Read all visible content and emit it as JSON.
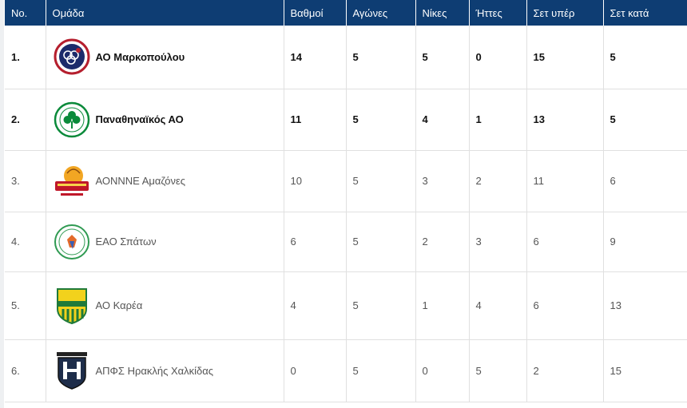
{
  "colors": {
    "header_bg": "#0e3d73",
    "header_text": "#ffffff",
    "row_border": "#e0e0e0",
    "text": "#555555"
  },
  "table": {
    "headers": [
      "No.",
      "Ομάδα",
      "Βαθμοί",
      "Αγώνες",
      "Νίκες",
      "Ήττες",
      "Σετ υπέρ",
      "Σετ κατά"
    ],
    "rows": [
      {
        "rank": "1.",
        "team": "ΑΟ Μαρκοπούλου",
        "logo_icon": "markopoulo-club-logo-icon",
        "points": "14",
        "games": "5",
        "wins": "5",
        "losses": "0",
        "sets_for": "15",
        "sets_against": "5",
        "bold": true
      },
      {
        "rank": "2.",
        "team": "Παναθηναϊκός ΑΟ",
        "logo_icon": "panathinaikos-shamrock-logo-icon",
        "points": "11",
        "games": "5",
        "wins": "4",
        "losses": "1",
        "sets_for": "13",
        "sets_against": "5",
        "bold": true
      },
      {
        "rank": "3.",
        "team": "ΑΟΝΝΝΕ Αμαζόνες",
        "logo_icon": "amazones-volleyball-logo-icon",
        "points": "10",
        "games": "5",
        "wins": "3",
        "losses": "2",
        "sets_for": "11",
        "sets_against": "6",
        "bold": false
      },
      {
        "rank": "4.",
        "team": "ΕΑΟ Σπάτων",
        "logo_icon": "spata-1991-logo-icon",
        "points": "6",
        "games": "5",
        "wins": "2",
        "losses": "3",
        "sets_for": "6",
        "sets_against": "9",
        "bold": false
      },
      {
        "rank": "5.",
        "team": "ΑΟ Καρέα",
        "logo_icon": "karea-shield-logo-icon",
        "points": "4",
        "games": "5",
        "wins": "1",
        "losses": "4",
        "sets_for": "6",
        "sets_against": "13",
        "bold": false
      },
      {
        "rank": "6.",
        "team": "ΑΠΦΣ Ηρακλής Χαλκίδας",
        "logo_icon": "iraklis-chalkida-logo-icon",
        "points": "0",
        "games": "5",
        "wins": "0",
        "losses": "5",
        "sets_for": "2",
        "sets_against": "15",
        "bold": false
      }
    ]
  }
}
